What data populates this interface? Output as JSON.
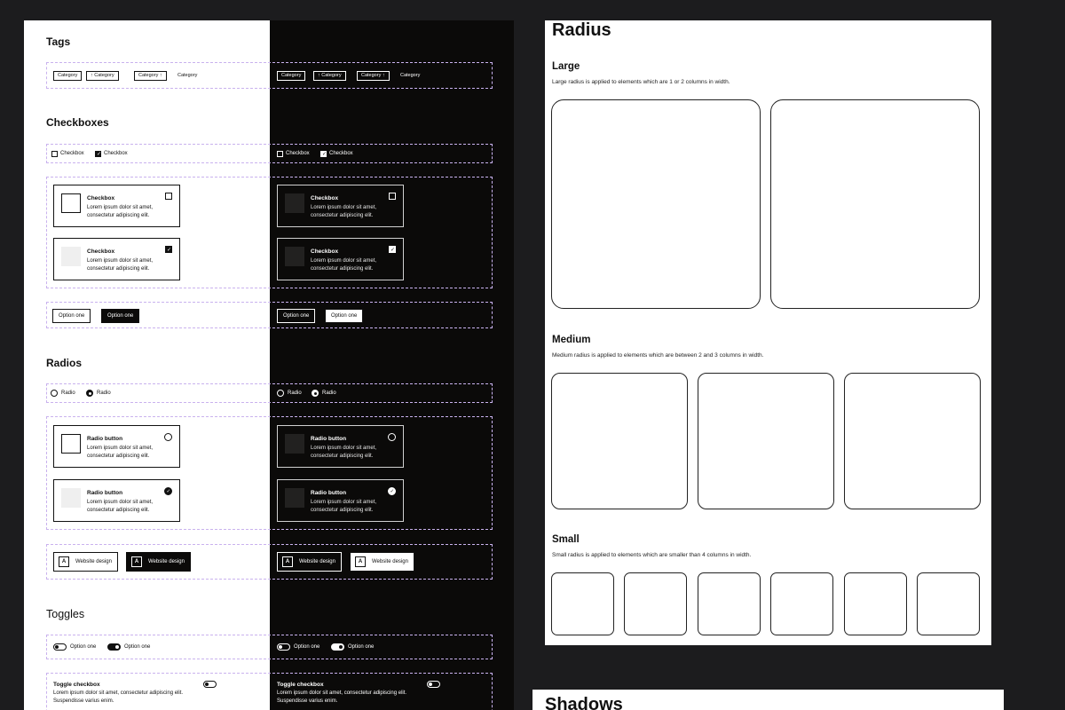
{
  "tags": {
    "heading": "Tags",
    "items": [
      "Category",
      "Category",
      "Category",
      "Category"
    ]
  },
  "checkboxes": {
    "heading": "Checkboxes",
    "inline": [
      "Checkbox",
      "Checkbox"
    ],
    "card_title": "Checkbox",
    "card_desc": "Lorem ipsum dolor sit amet, consectetur adipiscing elit.",
    "options": [
      "Option one",
      "Option one"
    ]
  },
  "radios": {
    "heading": "Radios",
    "inline": [
      "Radio",
      "Radio"
    ],
    "card_title": "Radio button",
    "card_desc": "Lorem ipsum dolor sit amet, consectetur adipiscing elit.",
    "web_label": "Website design",
    "icon_letter": "A"
  },
  "toggles": {
    "heading": "Toggles",
    "inline": [
      "Option one",
      "Option one"
    ],
    "card_title": "Toggle checkbox",
    "card_desc": "Lorem ipsum dolor sit amet, consectetur adipiscing elit. Suspendisse varius enim."
  },
  "radius": {
    "title": "Radius",
    "large": {
      "heading": "Large",
      "desc": "Large radius is applied to elements which are 1 or 2 columns in width."
    },
    "medium": {
      "heading": "Medium",
      "desc": "Medium radius is applied to elements which are between 2 and 3 columns in width."
    },
    "small": {
      "heading": "Small",
      "desc": "Small radius is applied to elements which are smaller than 4 columns in width."
    }
  },
  "shadows": {
    "title": "Shadows"
  },
  "icons": {
    "arrow": "arrow-up-icon",
    "check": "check-icon"
  },
  "colors": {
    "background": "#1c1c1e",
    "dark_panel": "#0b0a09",
    "guide": "#c9b2ee"
  }
}
